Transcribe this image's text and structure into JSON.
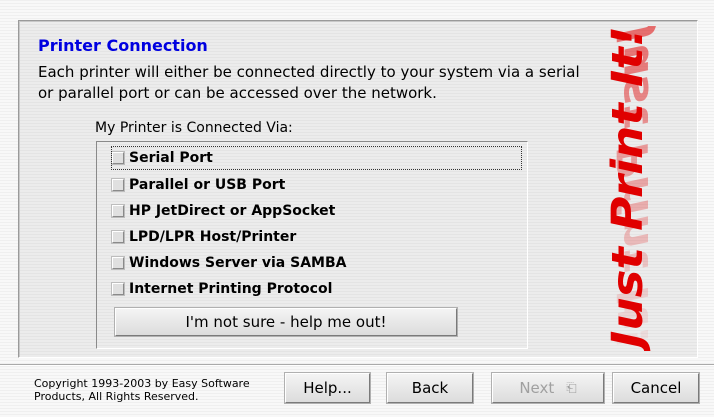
{
  "dialog": {
    "title": "Printer Connection",
    "description": "Each printer will either be connected directly to your system via a serial or parallel port or can be accessed over the network.",
    "group_label": "My Printer is Connected Via:",
    "options": [
      {
        "label": "Serial Port",
        "checked": false,
        "focused": true
      },
      {
        "label": "Parallel or USB Port",
        "checked": false
      },
      {
        "label": "HP JetDirect or AppSocket",
        "checked": false
      },
      {
        "label": "LPD/LPR Host/Printer",
        "checked": false
      },
      {
        "label": "Windows Server via SAMBA",
        "checked": false
      },
      {
        "label": "Internet Printing Protocol",
        "checked": false
      }
    ],
    "help_me_button": "I'm not sure - help me out!",
    "logo_text": "Just Print It!"
  },
  "footer": {
    "copyright_line1": "Copyright 1993-2003 by Easy Software",
    "copyright_line2": "Products, All Rights Reserved.",
    "help_button": "Help...",
    "back_button": "Back",
    "next_button": "Next",
    "next_icon": "enter-key-icon",
    "cancel_button": "Cancel"
  },
  "colors": {
    "title": "#0000e0",
    "logo_red": "#e00000"
  }
}
